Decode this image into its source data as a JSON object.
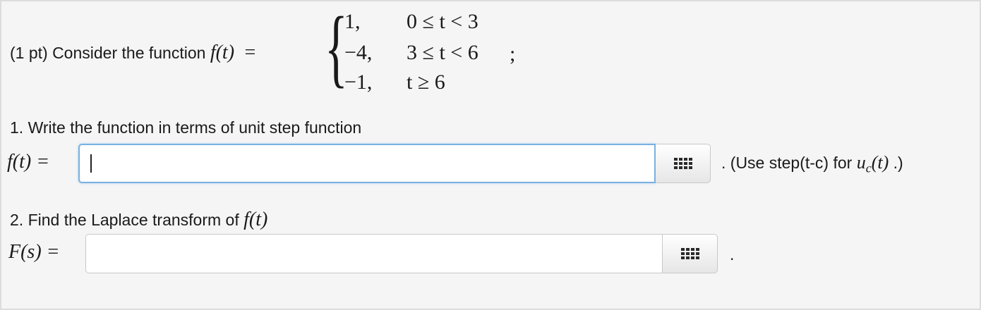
{
  "problem": {
    "intro": "(1 pt) Consider the function",
    "function_label": "f(t)",
    "equals": "=",
    "brace": "{",
    "cases": [
      {
        "value": "1,",
        "condition": "0 ≤ t < 3"
      },
      {
        "value": "−4,",
        "condition": "3 ≤ t < 6"
      },
      {
        "value": "−1,",
        "condition": "t ≥ 6"
      }
    ],
    "semicolon": ";"
  },
  "question1": {
    "prompt": "1. Write the function in terms of unit step function",
    "answer_label": "f(t) =",
    "answer_value": "",
    "hint_prefix": ". (Use step(t-c) for",
    "hint_math": "u",
    "hint_sub": "c",
    "hint_math_tail": "(t)",
    "hint_suffix": ".)",
    "palette_icon": "grid-icon"
  },
  "question2": {
    "prompt": "2. Find the Laplace transform of",
    "prompt_math": "f(t)",
    "answer_label": "F(s) =",
    "answer_value": "",
    "trailing": ".",
    "palette_icon": "grid-icon"
  }
}
